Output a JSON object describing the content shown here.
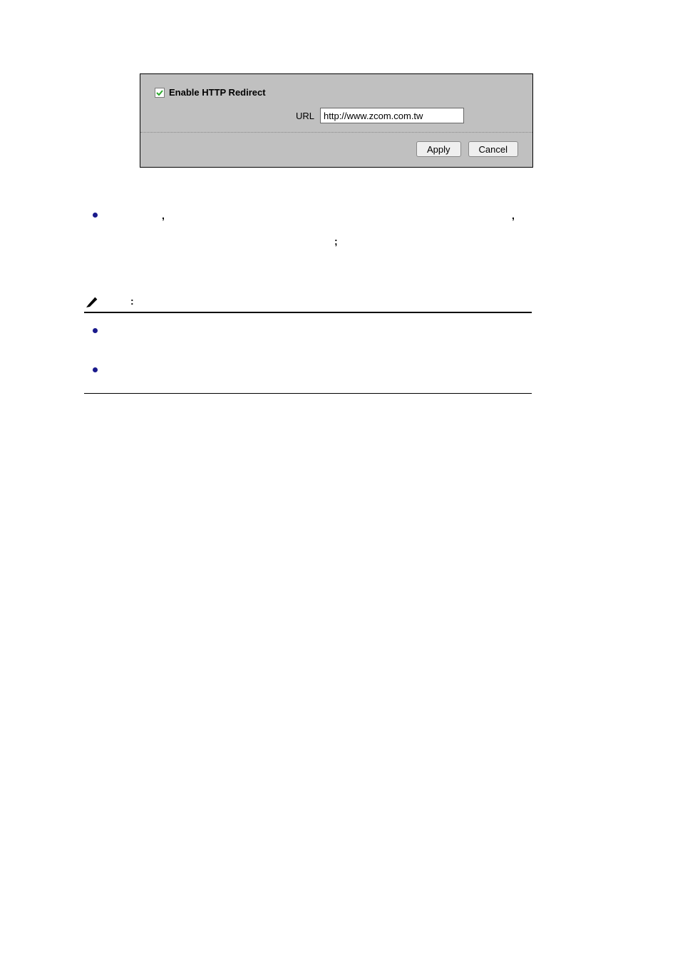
{
  "panel": {
    "checkbox_label": "Enable HTTP Redirect",
    "checkbox_checked": true,
    "url_label": "URL",
    "url_value": "http://www.zcom.com.tw",
    "apply_label": "Apply",
    "cancel_label": "Cancel"
  },
  "marks": {
    "comma": ",",
    "colon": ":",
    "semicolon": ";"
  }
}
